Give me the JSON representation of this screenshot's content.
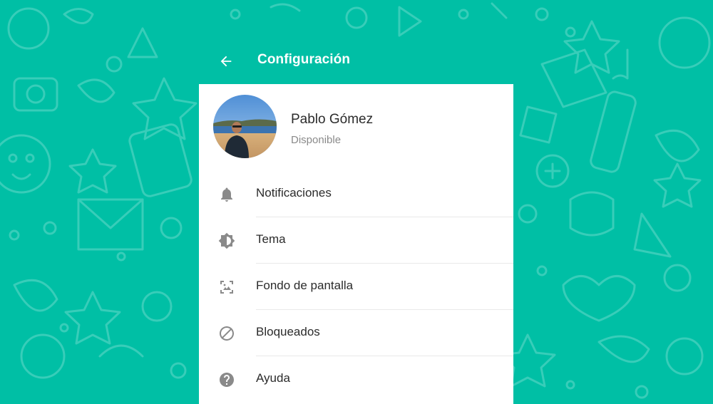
{
  "header": {
    "title": "Configuración",
    "back_icon": "arrow-left-icon"
  },
  "profile": {
    "name": "Pablo Gómez",
    "status": "Disponible"
  },
  "menu": [
    {
      "label": "Notificaciones",
      "icon": "bell-icon"
    },
    {
      "label": "Tema",
      "icon": "theme-icon"
    },
    {
      "label": "Fondo de pantalla",
      "icon": "wallpaper-icon"
    },
    {
      "label": "Bloqueados",
      "icon": "block-icon"
    },
    {
      "label": "Ayuda",
      "icon": "help-icon"
    }
  ],
  "colors": {
    "background": "#00bfa5",
    "panel": "#ffffff",
    "icon": "#8a8a8a",
    "text": "#2b2b2b",
    "secondary_text": "#8a8a8a"
  }
}
